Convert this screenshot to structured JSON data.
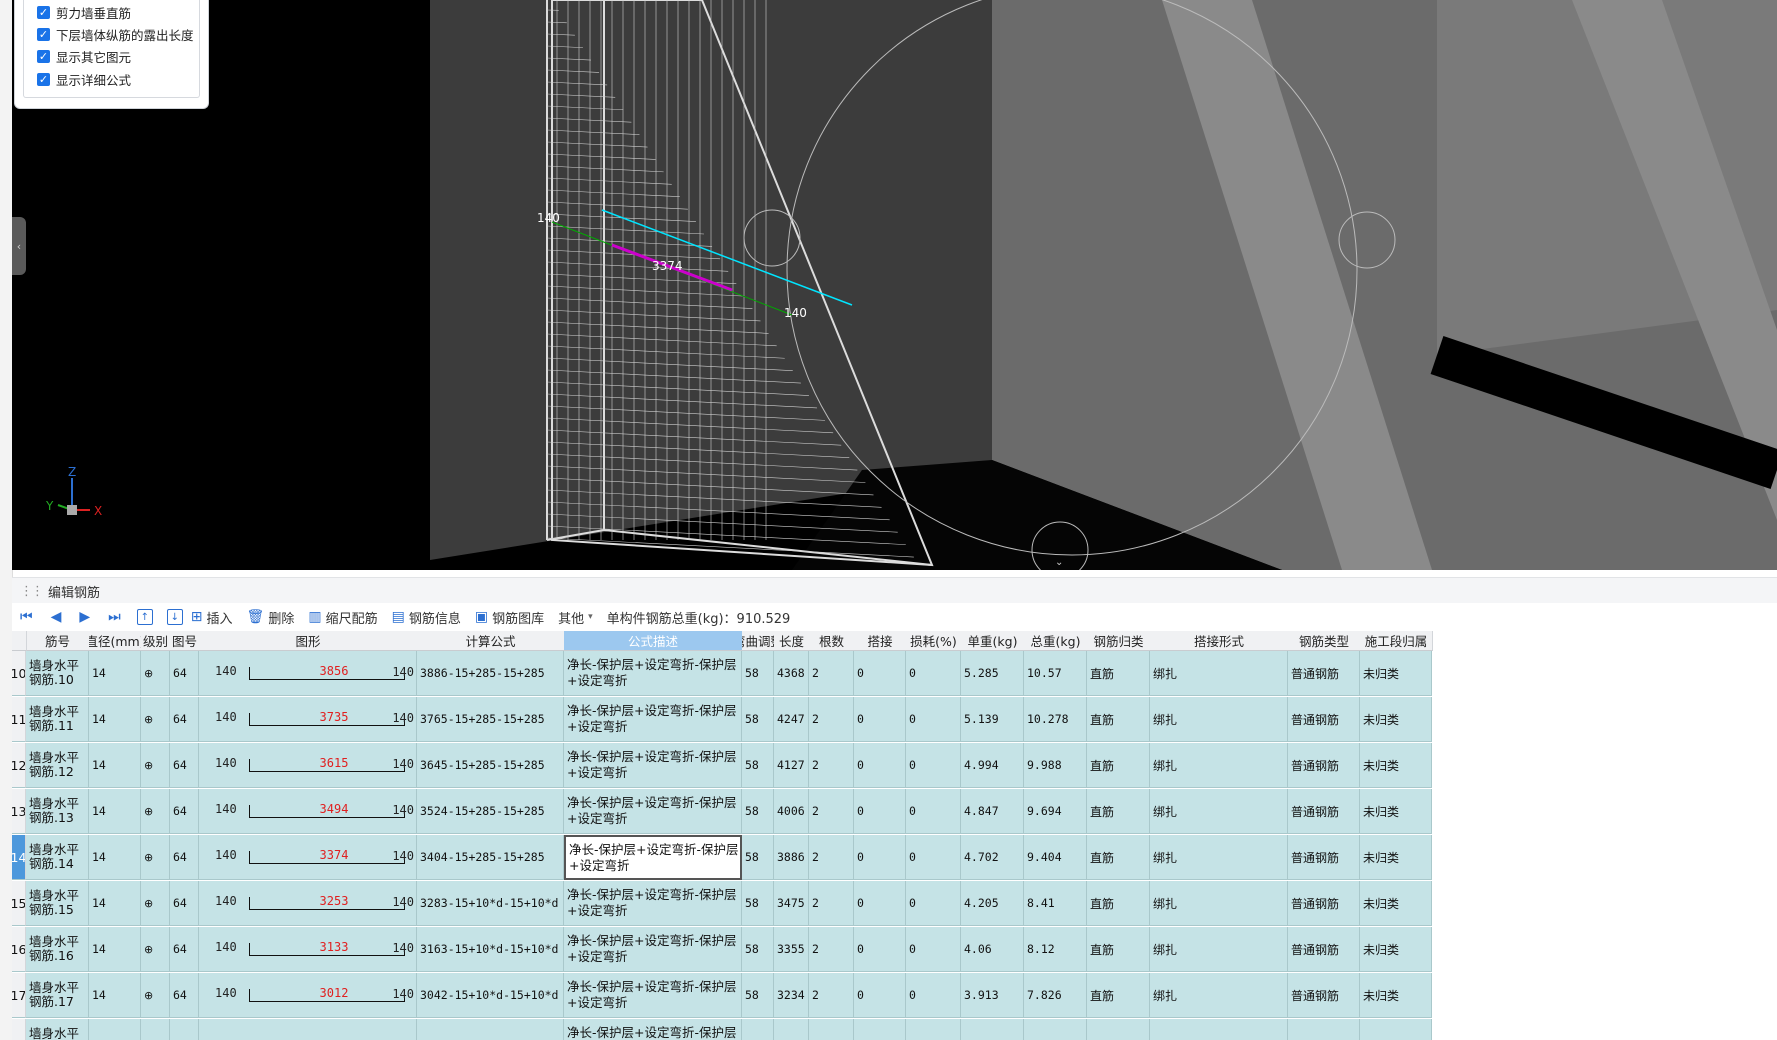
{
  "options": [
    {
      "label": "剪力墙垂直筋",
      "checked": true
    },
    {
      "label": "下层墙体纵筋的露出长度",
      "checked": true
    },
    {
      "label": "显示其它图元",
      "checked": true
    },
    {
      "label": "显示详细公式",
      "checked": true
    }
  ],
  "viewport": {
    "dim_left": "140",
    "dim_mid": "3374",
    "dim_right": "140",
    "axis_z": "Z",
    "axis_y": "Y",
    "axis_x": "X",
    "colors": {
      "background": "#000000",
      "cyan": "#00e5ff",
      "magenta": "#cc00cc",
      "green": "#00aa00",
      "wall": "#6b6b6b"
    }
  },
  "editor": {
    "title": "编辑钢筋"
  },
  "toolbar": {
    "insert": "插入",
    "delete": "删除",
    "scale": "缩尺配筋",
    "info": "钢筋信息",
    "library": "钢筋图库",
    "other": "其他",
    "total_label": "单构件钢筋总重(kg)：910.529"
  },
  "columns": [
    "筋号",
    "直径(mm)",
    "级别",
    "图号",
    "图形",
    "计算公式",
    "公式描述",
    "弯曲调整",
    "长度",
    "根数",
    "搭接",
    "损耗(%)",
    "单重(kg)",
    "总重(kg)",
    "钢筋归类",
    "搭接形式",
    "钢筋类型",
    "施工段归属"
  ],
  "rows": [
    {
      "no": "10",
      "name": "墙身水平钢筋.10",
      "dia": "14",
      "grade": "⊕",
      "fig": "64",
      "left": "140",
      "mid": "3856",
      "right": "140",
      "formula": "3886-15+285-15+285",
      "desc": "净长-保护层+设定弯折-保护层+设定弯折",
      "bend": "58",
      "len": "4368",
      "count": "2",
      "lap": "0",
      "loss": "0",
      "unit": "5.285",
      "total": "10.57",
      "cat": "直筋",
      "lapform": "绑扎",
      "type": "普通钢筋",
      "stage": "未归类"
    },
    {
      "no": "11",
      "name": "墙身水平钢筋.11",
      "dia": "14",
      "grade": "⊕",
      "fig": "64",
      "left": "140",
      "mid": "3735",
      "right": "140",
      "formula": "3765-15+285-15+285",
      "desc": "净长-保护层+设定弯折-保护层+设定弯折",
      "bend": "58",
      "len": "4247",
      "count": "2",
      "lap": "0",
      "loss": "0",
      "unit": "5.139",
      "total": "10.278",
      "cat": "直筋",
      "lapform": "绑扎",
      "type": "普通钢筋",
      "stage": "未归类"
    },
    {
      "no": "12",
      "name": "墙身水平钢筋.12",
      "dia": "14",
      "grade": "⊕",
      "fig": "64",
      "left": "140",
      "mid": "3615",
      "right": "140",
      "formula": "3645-15+285-15+285",
      "desc": "净长-保护层+设定弯折-保护层+设定弯折",
      "bend": "58",
      "len": "4127",
      "count": "2",
      "lap": "0",
      "loss": "0",
      "unit": "4.994",
      "total": "9.988",
      "cat": "直筋",
      "lapform": "绑扎",
      "type": "普通钢筋",
      "stage": "未归类"
    },
    {
      "no": "13",
      "name": "墙身水平钢筋.13",
      "dia": "14",
      "grade": "⊕",
      "fig": "64",
      "left": "140",
      "mid": "3494",
      "right": "140",
      "formula": "3524-15+285-15+285",
      "desc": "净长-保护层+设定弯折-保护层+设定弯折",
      "bend": "58",
      "len": "4006",
      "count": "2",
      "lap": "0",
      "loss": "0",
      "unit": "4.847",
      "total": "9.694",
      "cat": "直筋",
      "lapform": "绑扎",
      "type": "普通钢筋",
      "stage": "未归类"
    },
    {
      "no": "14",
      "name": "墙身水平钢筋.14",
      "dia": "14",
      "grade": "⊕",
      "fig": "64",
      "left": "140",
      "mid": "3374",
      "right": "140",
      "formula": "3404-15+285-15+285",
      "desc": "净长-保护层+设定弯折-保护层+设定弯折",
      "bend": "58",
      "len": "3886",
      "count": "2",
      "lap": "0",
      "loss": "0",
      "unit": "4.702",
      "total": "9.404",
      "cat": "直筋",
      "lapform": "绑扎",
      "type": "普通钢筋",
      "stage": "未归类",
      "selected": true
    },
    {
      "no": "15",
      "name": "墙身水平钢筋.15",
      "dia": "14",
      "grade": "⊕",
      "fig": "64",
      "left": "140",
      "mid": "3253",
      "right": "140",
      "formula": "3283-15+10*d-15+10*d",
      "desc": "净长-保护层+设定弯折-保护层+设定弯折",
      "bend": "58",
      "len": "3475",
      "count": "2",
      "lap": "0",
      "loss": "0",
      "unit": "4.205",
      "total": "8.41",
      "cat": "直筋",
      "lapform": "绑扎",
      "type": "普通钢筋",
      "stage": "未归类"
    },
    {
      "no": "16",
      "name": "墙身水平钢筋.16",
      "dia": "14",
      "grade": "⊕",
      "fig": "64",
      "left": "140",
      "mid": "3133",
      "right": "140",
      "formula": "3163-15+10*d-15+10*d",
      "desc": "净长-保护层+设定弯折-保护层+设定弯折",
      "bend": "58",
      "len": "3355",
      "count": "2",
      "lap": "0",
      "loss": "0",
      "unit": "4.06",
      "total": "8.12",
      "cat": "直筋",
      "lapform": "绑扎",
      "type": "普通钢筋",
      "stage": "未归类"
    },
    {
      "no": "17",
      "name": "墙身水平钢筋.17",
      "dia": "14",
      "grade": "⊕",
      "fig": "64",
      "left": "140",
      "mid": "3012",
      "right": "140",
      "formula": "3042-15+10*d-15+10*d",
      "desc": "净长-保护层+设定弯折-保护层+设定弯折",
      "bend": "58",
      "len": "3234",
      "count": "2",
      "lap": "0",
      "loss": "0",
      "unit": "3.913",
      "total": "7.826",
      "cat": "直筋",
      "lapform": "绑扎",
      "type": "普通钢筋",
      "stage": "未归类"
    },
    {
      "no": "",
      "name": "墙身水平钢",
      "dia": "",
      "grade": "",
      "fig": "",
      "left": "",
      "mid": "",
      "right": "",
      "formula": "",
      "desc": "净长-保护层+设定弯折-保护层+设定",
      "bend": "",
      "len": "",
      "count": "",
      "lap": "",
      "loss": "",
      "unit": "",
      "total": "",
      "cat": "",
      "lapform": "",
      "type": "",
      "stage": ""
    }
  ]
}
